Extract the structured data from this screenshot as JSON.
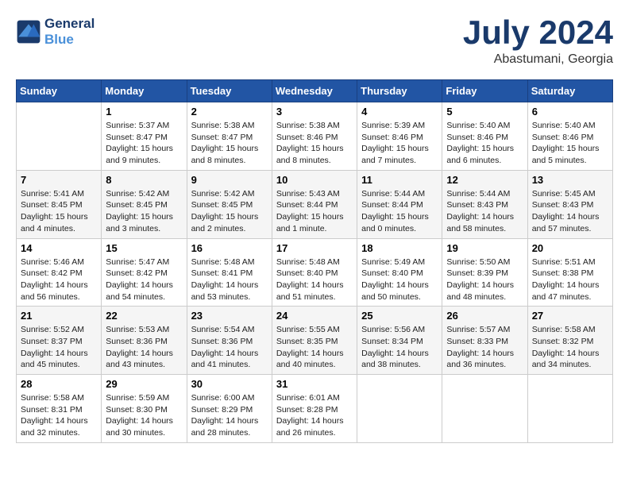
{
  "header": {
    "logo_line1": "General",
    "logo_line2": "Blue",
    "month_title": "July 2024",
    "location": "Abastumani, Georgia"
  },
  "weekdays": [
    "Sunday",
    "Monday",
    "Tuesday",
    "Wednesday",
    "Thursday",
    "Friday",
    "Saturday"
  ],
  "weeks": [
    [
      {
        "day": "",
        "info": ""
      },
      {
        "day": "1",
        "info": "Sunrise: 5:37 AM\nSunset: 8:47 PM\nDaylight: 15 hours\nand 9 minutes."
      },
      {
        "day": "2",
        "info": "Sunrise: 5:38 AM\nSunset: 8:47 PM\nDaylight: 15 hours\nand 8 minutes."
      },
      {
        "day": "3",
        "info": "Sunrise: 5:38 AM\nSunset: 8:46 PM\nDaylight: 15 hours\nand 8 minutes."
      },
      {
        "day": "4",
        "info": "Sunrise: 5:39 AM\nSunset: 8:46 PM\nDaylight: 15 hours\nand 7 minutes."
      },
      {
        "day": "5",
        "info": "Sunrise: 5:40 AM\nSunset: 8:46 PM\nDaylight: 15 hours\nand 6 minutes."
      },
      {
        "day": "6",
        "info": "Sunrise: 5:40 AM\nSunset: 8:46 PM\nDaylight: 15 hours\nand 5 minutes."
      }
    ],
    [
      {
        "day": "7",
        "info": "Sunrise: 5:41 AM\nSunset: 8:45 PM\nDaylight: 15 hours\nand 4 minutes."
      },
      {
        "day": "8",
        "info": "Sunrise: 5:42 AM\nSunset: 8:45 PM\nDaylight: 15 hours\nand 3 minutes."
      },
      {
        "day": "9",
        "info": "Sunrise: 5:42 AM\nSunset: 8:45 PM\nDaylight: 15 hours\nand 2 minutes."
      },
      {
        "day": "10",
        "info": "Sunrise: 5:43 AM\nSunset: 8:44 PM\nDaylight: 15 hours\nand 1 minute."
      },
      {
        "day": "11",
        "info": "Sunrise: 5:44 AM\nSunset: 8:44 PM\nDaylight: 15 hours\nand 0 minutes."
      },
      {
        "day": "12",
        "info": "Sunrise: 5:44 AM\nSunset: 8:43 PM\nDaylight: 14 hours\nand 58 minutes."
      },
      {
        "day": "13",
        "info": "Sunrise: 5:45 AM\nSunset: 8:43 PM\nDaylight: 14 hours\nand 57 minutes."
      }
    ],
    [
      {
        "day": "14",
        "info": "Sunrise: 5:46 AM\nSunset: 8:42 PM\nDaylight: 14 hours\nand 56 minutes."
      },
      {
        "day": "15",
        "info": "Sunrise: 5:47 AM\nSunset: 8:42 PM\nDaylight: 14 hours\nand 54 minutes."
      },
      {
        "day": "16",
        "info": "Sunrise: 5:48 AM\nSunset: 8:41 PM\nDaylight: 14 hours\nand 53 minutes."
      },
      {
        "day": "17",
        "info": "Sunrise: 5:48 AM\nSunset: 8:40 PM\nDaylight: 14 hours\nand 51 minutes."
      },
      {
        "day": "18",
        "info": "Sunrise: 5:49 AM\nSunset: 8:40 PM\nDaylight: 14 hours\nand 50 minutes."
      },
      {
        "day": "19",
        "info": "Sunrise: 5:50 AM\nSunset: 8:39 PM\nDaylight: 14 hours\nand 48 minutes."
      },
      {
        "day": "20",
        "info": "Sunrise: 5:51 AM\nSunset: 8:38 PM\nDaylight: 14 hours\nand 47 minutes."
      }
    ],
    [
      {
        "day": "21",
        "info": "Sunrise: 5:52 AM\nSunset: 8:37 PM\nDaylight: 14 hours\nand 45 minutes."
      },
      {
        "day": "22",
        "info": "Sunrise: 5:53 AM\nSunset: 8:36 PM\nDaylight: 14 hours\nand 43 minutes."
      },
      {
        "day": "23",
        "info": "Sunrise: 5:54 AM\nSunset: 8:36 PM\nDaylight: 14 hours\nand 41 minutes."
      },
      {
        "day": "24",
        "info": "Sunrise: 5:55 AM\nSunset: 8:35 PM\nDaylight: 14 hours\nand 40 minutes."
      },
      {
        "day": "25",
        "info": "Sunrise: 5:56 AM\nSunset: 8:34 PM\nDaylight: 14 hours\nand 38 minutes."
      },
      {
        "day": "26",
        "info": "Sunrise: 5:57 AM\nSunset: 8:33 PM\nDaylight: 14 hours\nand 36 minutes."
      },
      {
        "day": "27",
        "info": "Sunrise: 5:58 AM\nSunset: 8:32 PM\nDaylight: 14 hours\nand 34 minutes."
      }
    ],
    [
      {
        "day": "28",
        "info": "Sunrise: 5:58 AM\nSunset: 8:31 PM\nDaylight: 14 hours\nand 32 minutes."
      },
      {
        "day": "29",
        "info": "Sunrise: 5:59 AM\nSunset: 8:30 PM\nDaylight: 14 hours\nand 30 minutes."
      },
      {
        "day": "30",
        "info": "Sunrise: 6:00 AM\nSunset: 8:29 PM\nDaylight: 14 hours\nand 28 minutes."
      },
      {
        "day": "31",
        "info": "Sunrise: 6:01 AM\nSunset: 8:28 PM\nDaylight: 14 hours\nand 26 minutes."
      },
      {
        "day": "",
        "info": ""
      },
      {
        "day": "",
        "info": ""
      },
      {
        "day": "",
        "info": ""
      }
    ]
  ]
}
